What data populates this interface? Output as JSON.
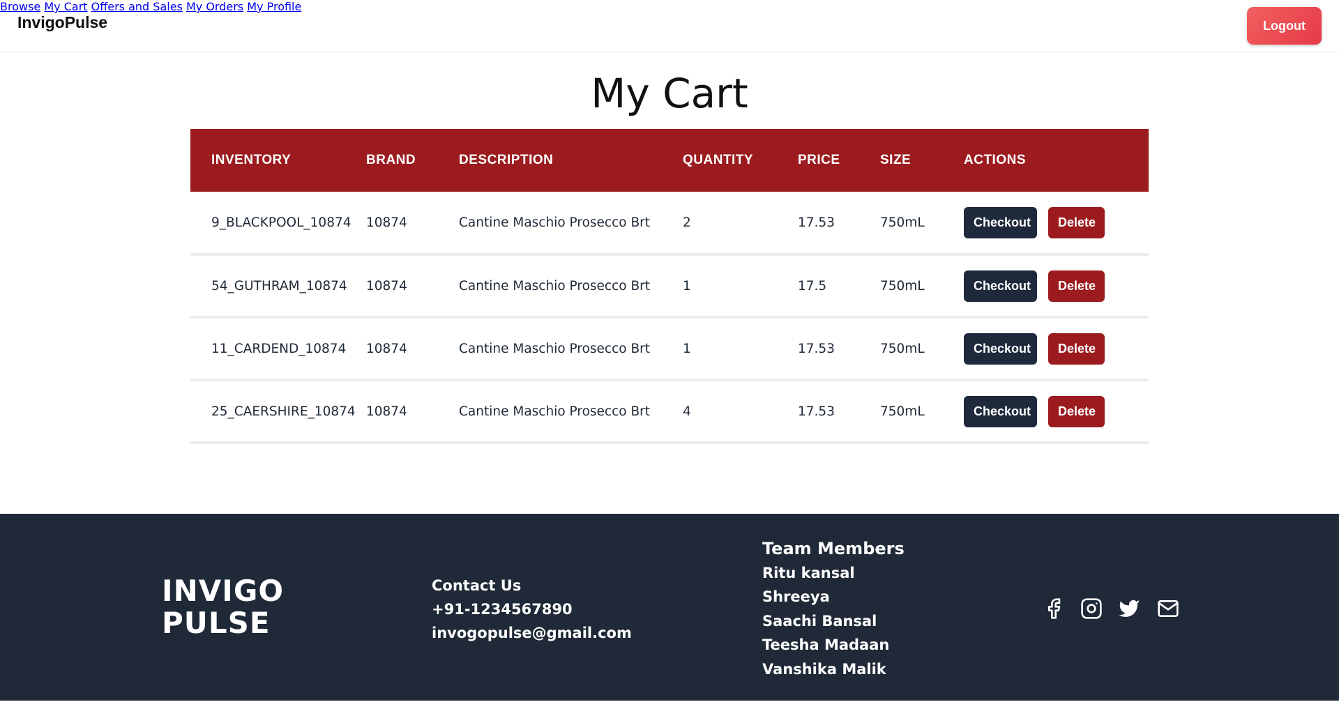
{
  "header": {
    "brand": "InvigoPulse",
    "nav": [
      {
        "label": "Browse"
      },
      {
        "label": "My Cart"
      },
      {
        "label": "Offers and Sales"
      },
      {
        "label": "My Orders"
      },
      {
        "label": "My Profile"
      }
    ],
    "logout_label": "Logout"
  },
  "page": {
    "title": "My Cart"
  },
  "table": {
    "headers": [
      "INVENTORY",
      "BRAND",
      "DESCRIPTION",
      "QUANTITY",
      "PRICE",
      "SIZE",
      "ACTIONS"
    ],
    "rows": [
      {
        "inventory": "9_BLACKPOOL_10874",
        "brand": "10874",
        "description": "Cantine Maschio Prosecco Brt",
        "quantity": "2",
        "price": "17.53",
        "size": "750mL"
      },
      {
        "inventory": "54_GUTHRAM_10874",
        "brand": "10874",
        "description": "Cantine Maschio Prosecco Brt",
        "quantity": "1",
        "price": "17.5",
        "size": "750mL"
      },
      {
        "inventory": "11_CARDEND_10874",
        "brand": "10874",
        "description": "Cantine Maschio Prosecco Brt",
        "quantity": "1",
        "price": "17.53",
        "size": "750mL"
      },
      {
        "inventory": "25_CAERSHIRE_10874",
        "brand": "10874",
        "description": "Cantine Maschio Prosecco Brt",
        "quantity": "4",
        "price": "17.53",
        "size": "750mL"
      }
    ],
    "checkout_label": "Checkout",
    "delete_label": "Delete"
  },
  "footer": {
    "logo_line1": "INVIGO",
    "logo_line2": "PULSE",
    "contact_heading": "Contact Us",
    "phone": "+91-1234567890",
    "email": "invogopulse@gmail.com",
    "team_heading": "Team Members",
    "team": [
      "Ritu kansal",
      "Shreeya",
      "Saachi Bansal",
      "Teesha Madaan",
      "Vanshika Malik"
    ],
    "socials": [
      "facebook-icon",
      "instagram-icon",
      "twitter-icon",
      "mail-icon"
    ]
  },
  "colors": {
    "header_row": "#9b1b1f",
    "checkout_button": "#1e293b",
    "delete_button": "#9b1b1f",
    "logout_button": "#e53945",
    "footer_bg": "#1f2937"
  }
}
